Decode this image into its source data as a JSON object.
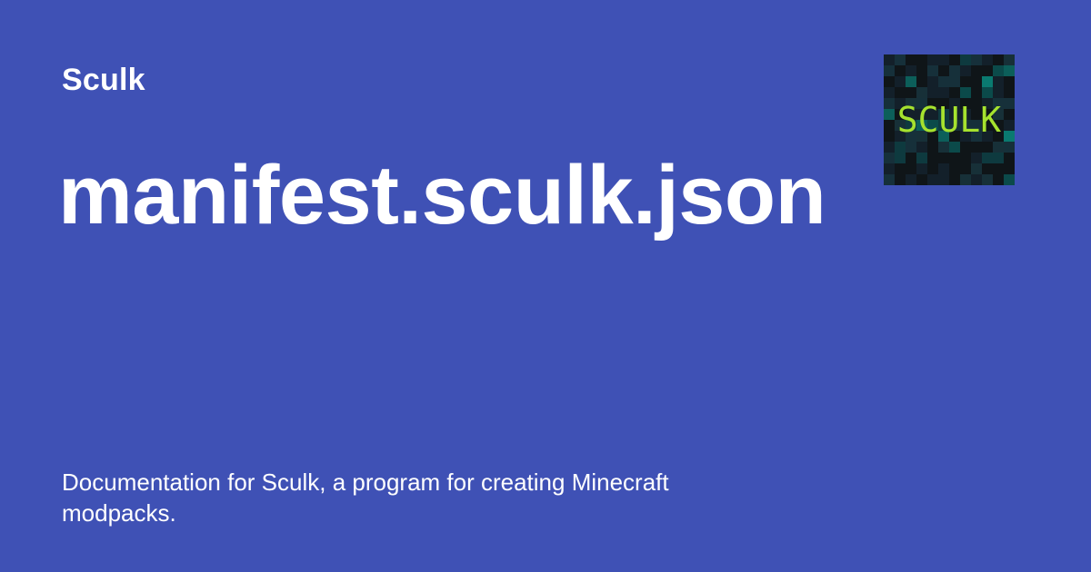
{
  "site": {
    "name": "Sculk"
  },
  "page": {
    "title": "manifest.sculk.json",
    "description": "Documentation for Sculk, a program for creating Minecraft modpacks."
  },
  "logo": {
    "text": "SCULK",
    "text_color": "#a6e22e",
    "background_color": "#0f1518",
    "pixel_colors": [
      "#0f1518",
      "#13202a",
      "#16303a",
      "#0e3a3f",
      "#0b4a4a",
      "#0c5f5a",
      "#0a7a70",
      "#173038"
    ]
  },
  "theme": {
    "background_color": "#3f51b5",
    "text_color": "#ffffff"
  }
}
